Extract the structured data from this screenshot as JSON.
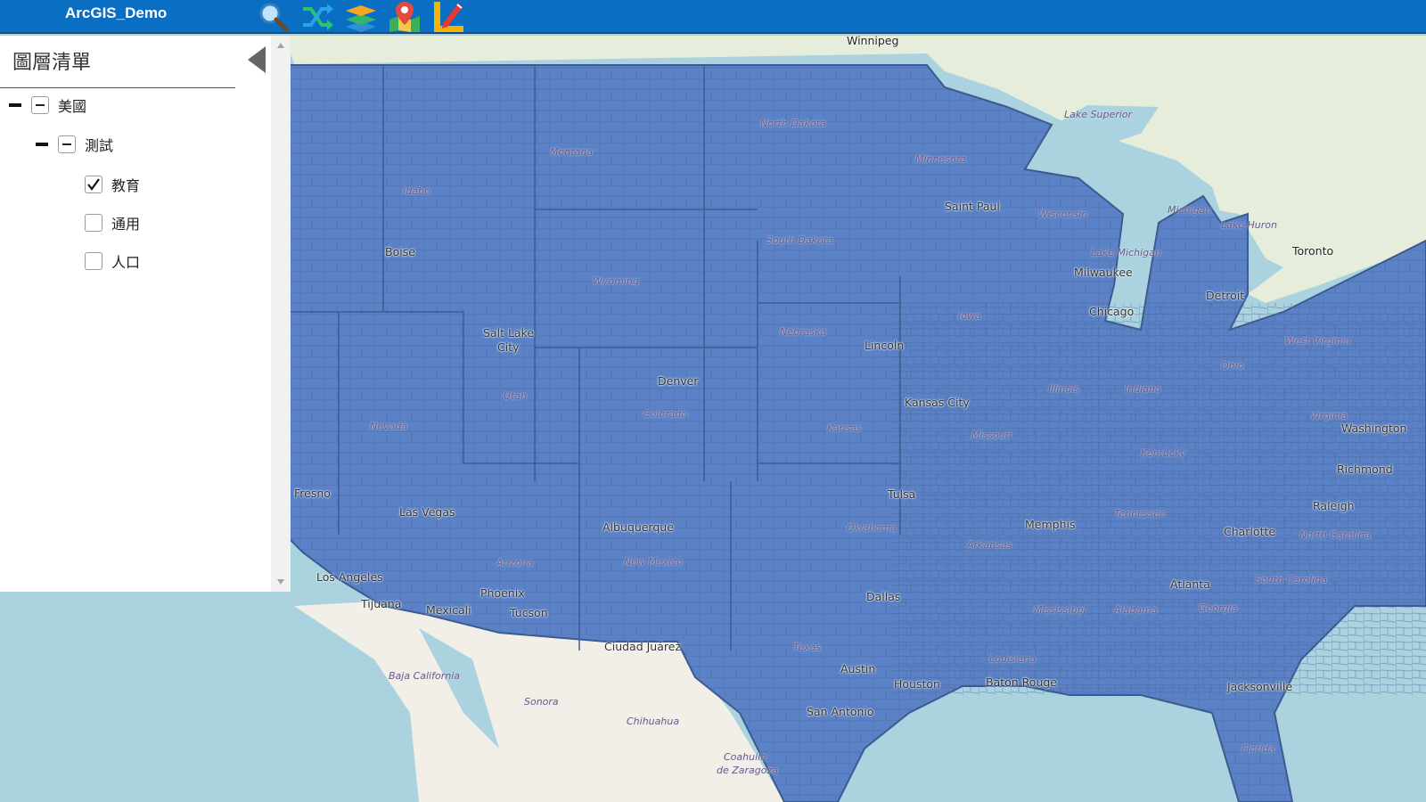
{
  "app": {
    "title": "ArcGIS_Demo"
  },
  "toolbar": [
    {
      "name": "search-icon"
    },
    {
      "name": "shuffle-icon"
    },
    {
      "name": "layers-icon"
    },
    {
      "name": "map-pin-icon"
    },
    {
      "name": "measure-ruler-icon"
    }
  ],
  "panel": {
    "title": "圖層清單",
    "tree": {
      "root": {
        "label": "美國",
        "state": "partial"
      },
      "group": {
        "label": "測試",
        "state": "partial"
      },
      "layers": [
        {
          "label": "教育",
          "checked": true
        },
        {
          "label": "通用",
          "checked": false
        },
        {
          "label": "人口",
          "checked": false
        }
      ]
    }
  },
  "map": {
    "cities": [
      "Winnipeg",
      "Boise",
      "Salt Lake City",
      "Denver",
      "Lincoln",
      "Kansas City",
      "Saint Paul",
      "Milwaukee",
      "Chicago",
      "Detroit",
      "Toronto",
      "Fresno",
      "Las Vegas",
      "Los Angeles",
      "Tijuana",
      "Mexicali",
      "Phoenix",
      "Tucson",
      "Albuquerque",
      "Ciudad Juárez",
      "Tulsa",
      "Dallas",
      "Austin",
      "Houston",
      "San Antonio",
      "Baton Rouge",
      "Memphis",
      "Atlanta",
      "Charlotte",
      "Raleigh",
      "Richmond",
      "Washington",
      "Jacksonville"
    ],
    "regions": [
      "North Dakota",
      "Montana",
      "Idaho",
      "Wyoming",
      "South Dakota",
      "Minnesota",
      "Wisconsin",
      "Michigan",
      "Lake Superior",
      "Lake Huron",
      "Lake Michigan",
      "Nebraska",
      "Iowa",
      "Utah",
      "Colorado",
      "Nevada",
      "Kansas",
      "Missouri",
      "Illinois",
      "Indiana",
      "Ohio",
      "Oklahoma",
      "Arizona",
      "New Mexico",
      "Texas",
      "Arkansas",
      "Tennessee",
      "Mississippi",
      "Alabama",
      "Louisiana",
      "Georgia",
      "South Carolina",
      "North Carolina",
      "Virginia",
      "West Virginia",
      "Kentucky",
      "Florida",
      "Baja California",
      "Sonora",
      "Chihuahua",
      "Coahuila de Zaragoza"
    ],
    "colors": {
      "fill": "#5b82c6",
      "border": "#3d5a8f",
      "water": "#aad3df",
      "land": "#f2efe9",
      "canada_land": "#e4eedb"
    }
  }
}
